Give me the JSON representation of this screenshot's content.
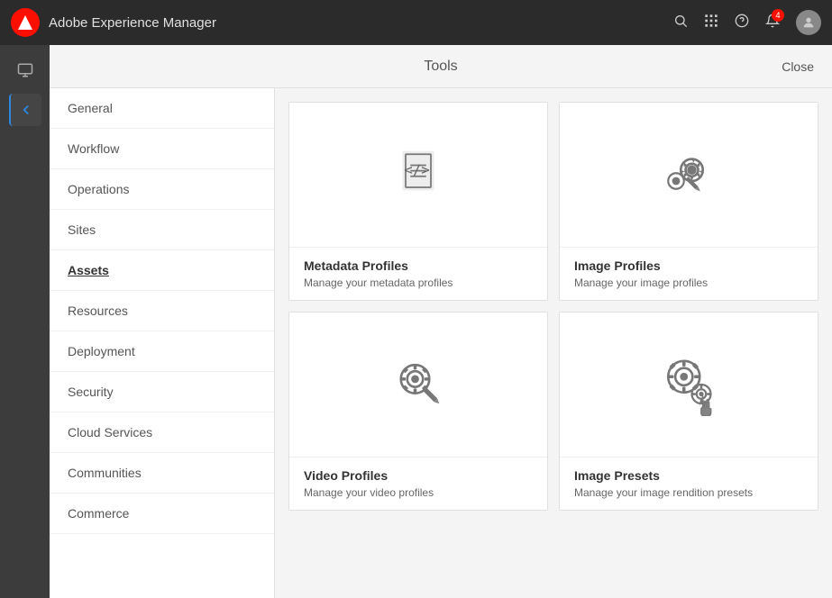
{
  "app": {
    "title": "Adobe Experience Manager",
    "logo_color": "#fa0f00"
  },
  "topnav": {
    "search_icon": "⌕",
    "grid_icon": "⋮⋮",
    "help_icon": "?",
    "bell_badge": "4",
    "close_label": "Close",
    "tools_title": "Tools"
  },
  "sidebar": {
    "items": [
      {
        "label": "General",
        "active": false
      },
      {
        "label": "Workflow",
        "active": false
      },
      {
        "label": "Operations",
        "active": false
      },
      {
        "label": "Sites",
        "active": false
      },
      {
        "label": "Assets",
        "active": true
      },
      {
        "label": "Resources",
        "active": false
      },
      {
        "label": "Deployment",
        "active": false
      },
      {
        "label": "Security",
        "active": false
      },
      {
        "label": "Cloud Services",
        "active": false
      },
      {
        "label": "Communities",
        "active": false
      },
      {
        "label": "Commerce",
        "active": false
      }
    ]
  },
  "cards": [
    {
      "id": "metadata-profiles",
      "title": "Metadata Profiles",
      "desc": "Manage your metadata profiles",
      "icon": "metadata"
    },
    {
      "id": "image-profiles",
      "title": "Image Profiles",
      "desc": "Manage your image profiles",
      "icon": "gear-pencil"
    },
    {
      "id": "video-profiles",
      "title": "Video Profiles",
      "desc": "Manage your video profiles",
      "icon": "gear-pencil-small"
    },
    {
      "id": "image-presets",
      "title": "Image Presets",
      "desc": "Manage your image rendition presets",
      "icon": "gear-cursor"
    }
  ]
}
